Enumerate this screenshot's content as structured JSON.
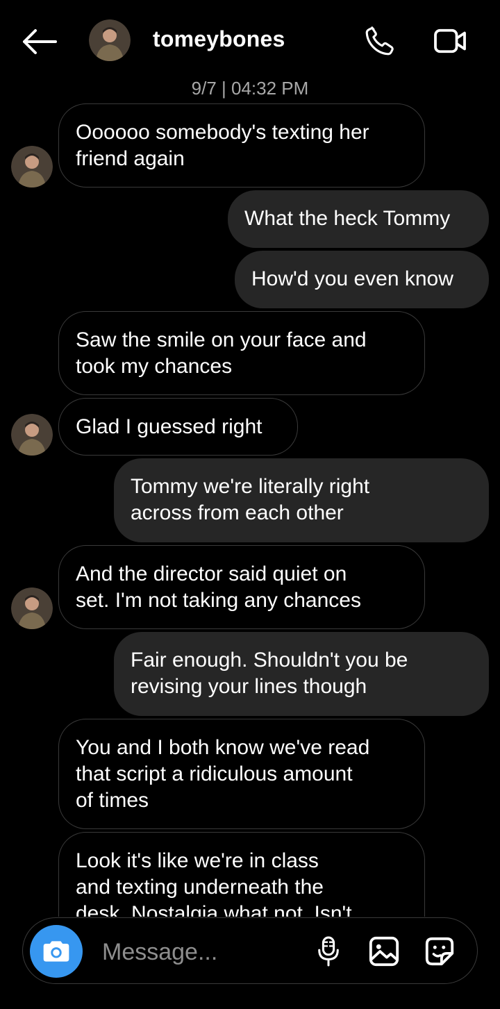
{
  "header": {
    "username": "tomeybones"
  },
  "timestamp": "9/7 | 04:32 PM",
  "messages": [
    {
      "side": "in",
      "text": "Oooooo somebody's texting her\nfriend again"
    },
    {
      "side": "out",
      "text": "What the heck Tommy"
    },
    {
      "side": "out",
      "text": "How'd you even know"
    },
    {
      "side": "in",
      "text": "Saw the smile on your face and\ntook my chances"
    },
    {
      "side": "in",
      "text": "Glad I guessed right"
    },
    {
      "side": "out",
      "text": "Tommy we're literally right\nacross from each other"
    },
    {
      "side": "in",
      "text": "And the director said quiet on\nset. I'm not taking any chances"
    },
    {
      "side": "out",
      "text": "Fair enough. Shouldn't you be\nrevising your lines though"
    },
    {
      "side": "in",
      "text": "You and I both know we've read\nthat script a ridiculous amount\nof times"
    },
    {
      "side": "in",
      "text": "Look it's like we're in class\nand texting underneath the\ndesk. Nostalgia what not. Isn't"
    }
  ],
  "composer": {
    "placeholder": "Message..."
  },
  "colors": {
    "accent": "#3797f0",
    "outgoing_bubble": "#262626",
    "incoming_border": "#3a3a3a"
  },
  "icons": [
    "back-arrow-icon",
    "phone-icon",
    "video-camera-icon",
    "camera-icon",
    "microphone-icon",
    "gallery-icon",
    "sticker-icon"
  ]
}
